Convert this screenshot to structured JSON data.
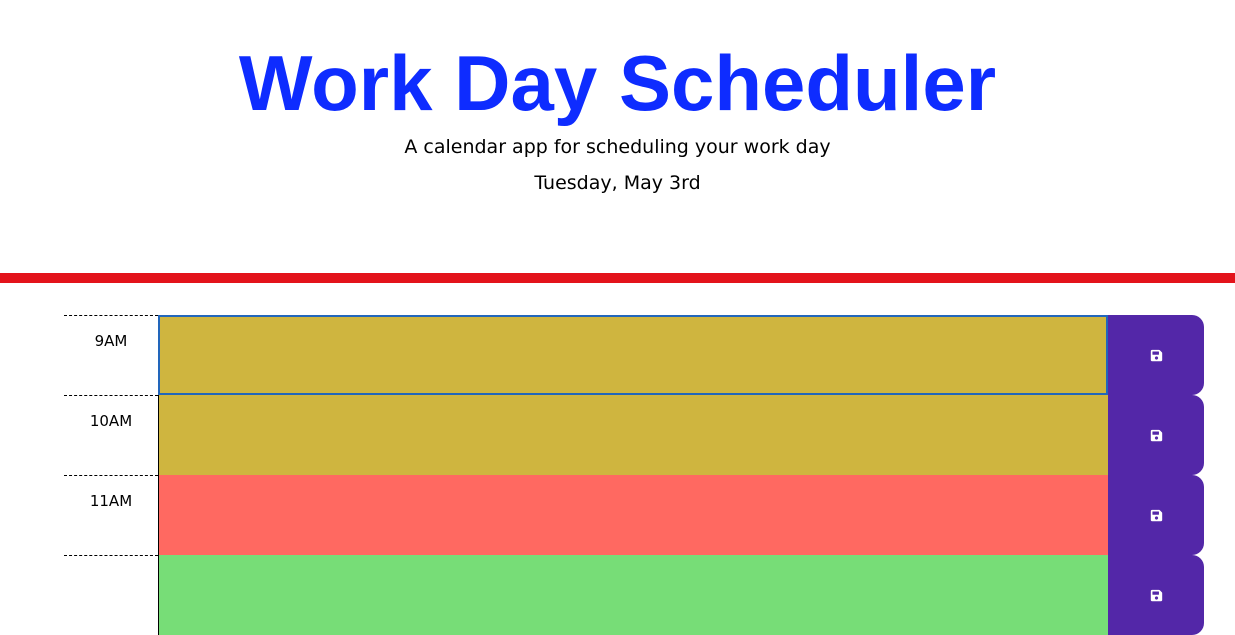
{
  "header": {
    "title": "Work Day Scheduler",
    "subtitle": "A calendar app for scheduling your work day",
    "current_day": "Tuesday, May 3rd"
  },
  "colors": {
    "title": "#0e2cff",
    "divider": "#e3131b",
    "past": "#cfb53f",
    "present": "#ff6961",
    "future": "#77dd77",
    "save_button": "#5327a8"
  },
  "time_blocks": [
    {
      "hour": "9AM",
      "value": "",
      "status": "past",
      "color": "#cfb53f",
      "save_icon": "floppy-disk-icon"
    },
    {
      "hour": "10AM",
      "value": "",
      "status": "past",
      "color": "#cfb53f",
      "save_icon": "floppy-disk-icon"
    },
    {
      "hour": "11AM",
      "value": "",
      "status": "present",
      "color": "#ff6961",
      "save_icon": "floppy-disk-icon"
    },
    {
      "hour": "",
      "value": "",
      "status": "future",
      "color": "#77dd77",
      "save_icon": "floppy-disk-icon"
    }
  ]
}
